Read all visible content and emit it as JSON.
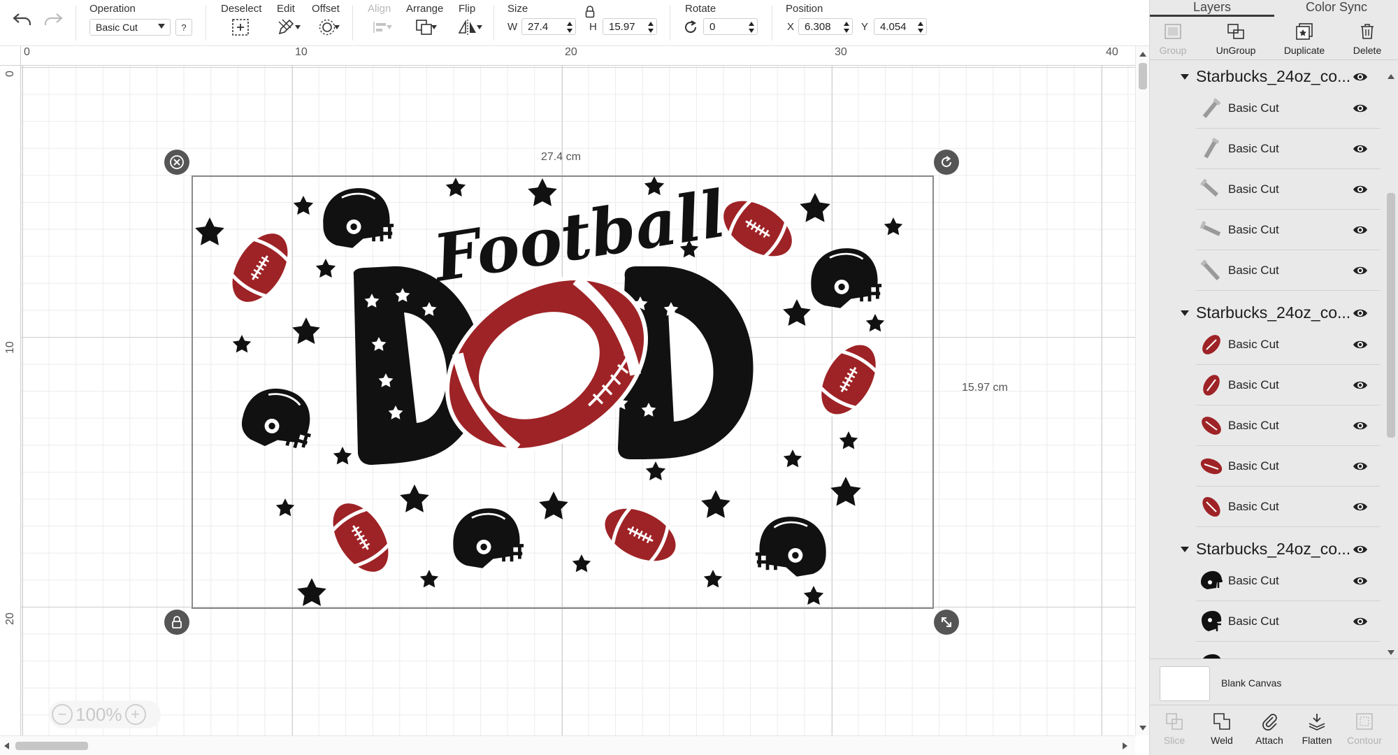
{
  "toolbar": {
    "operation": {
      "label": "Operation",
      "value": "Basic Cut",
      "help": "?"
    },
    "deselect": {
      "label": "Deselect"
    },
    "edit": {
      "label": "Edit"
    },
    "offset": {
      "label": "Offset"
    },
    "align": {
      "label": "Align"
    },
    "arrange": {
      "label": "Arrange"
    },
    "flip": {
      "label": "Flip"
    },
    "size": {
      "label": "Size",
      "w_prefix": "W",
      "w_value": "27.4",
      "h_prefix": "H",
      "h_value": "15.97"
    },
    "rotate": {
      "label": "Rotate",
      "value": "0"
    },
    "position": {
      "label": "Position",
      "x_prefix": "X",
      "x_value": "6.308",
      "y_prefix": "Y",
      "y_value": "4.054"
    }
  },
  "rulers": {
    "top": [
      "0",
      "10",
      "20",
      "30",
      "40"
    ],
    "left": [
      "0",
      "10",
      "20"
    ]
  },
  "canvas": {
    "width_label": "27.4 cm",
    "height_label": "15.97 cm",
    "zoom": "100%",
    "artwork_text_top": "Football",
    "artwork_text_main": "DAD",
    "colors": {
      "red": "#9e2326",
      "black": "#111111",
      "white": "#ffffff"
    }
  },
  "panel": {
    "tabs": [
      "Layers",
      "Color Sync"
    ],
    "actions": [
      {
        "label": "Group",
        "icon": "group-icon",
        "enabled": false
      },
      {
        "label": "UnGroup",
        "icon": "ungroup-icon",
        "enabled": true
      },
      {
        "label": "Duplicate",
        "icon": "duplicate-icon",
        "enabled": true
      },
      {
        "label": "Delete",
        "icon": "trash-icon",
        "enabled": true
      }
    ],
    "groups": [
      {
        "name": "Starbucks_24oz_co...",
        "thumb": "grey",
        "layers": [
          "Basic Cut",
          "Basic Cut",
          "Basic Cut",
          "Basic Cut",
          "Basic Cut"
        ]
      },
      {
        "name": "Starbucks_24oz_co...",
        "thumb": "red",
        "layers": [
          "Basic Cut",
          "Basic Cut",
          "Basic Cut",
          "Basic Cut",
          "Basic Cut"
        ]
      },
      {
        "name": "Starbucks_24oz_co...",
        "thumb": "black",
        "layers": [
          "Basic Cut",
          "Basic Cut"
        ]
      }
    ],
    "blank_canvas": "Blank Canvas",
    "bottom_actions": [
      {
        "label": "Slice",
        "enabled": false
      },
      {
        "label": "Weld",
        "enabled": true
      },
      {
        "label": "Attach",
        "enabled": true
      },
      {
        "label": "Flatten",
        "enabled": true
      },
      {
        "label": "Contour",
        "enabled": false
      }
    ]
  }
}
